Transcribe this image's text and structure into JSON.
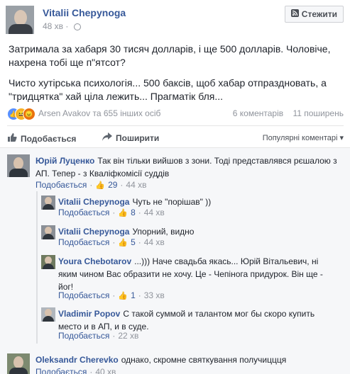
{
  "post": {
    "author": "Vitalii Chepynoga",
    "time": "48 хв",
    "follow_label": "Стежити",
    "paragraphs": [
      "Затримала за хабаря 30 тисяч долларів, і ще 500 долларів. Чоловіче, нахрена тобі ще п\"ятсот?",
      "Чисто хутірська психологія... 500 баксів, щоб хабар отпраздновать, а \"тридцятка\" хай ціла лежить... Прагматік бля..."
    ]
  },
  "reactions": {
    "summary": "Arsen Avakov та 655 інших осіб",
    "comments_count": "6 коментарів",
    "shares_count": "11 поширень"
  },
  "actions": {
    "like": "Подобається",
    "share": "Поширити",
    "sort": "Популярні коментарі ▾"
  },
  "comments": [
    {
      "name": "Юрій Луценко",
      "text": "Так він тільки вийшов з зони. Тоді представлявся рєшалою з АП. Тепер - з Кваліфкомісії суддів",
      "like": "Подобається",
      "likes": "29",
      "time": "44 хв"
    },
    {
      "name": "Vitalii Chepynoga",
      "text": "Чуть не \"порішав\" ))",
      "like": "Подобається",
      "likes": "8",
      "time": "44 хв"
    },
    {
      "name": "Vitalii Chepynoga",
      "text": "Упорний, видно",
      "like": "Подобається",
      "likes": "5",
      "time": "44 хв"
    },
    {
      "name": "Youra Chebotarov",
      "text": "...))) Наче свадьба якась... Юрій Вітальевич, ні яким чином Вас образити не хочу. Це - Чепінога придурок. Він ще - йог!",
      "like": "Подобається",
      "likes": "1",
      "time": "33 хв"
    },
    {
      "name": "Vladimir Popov",
      "text": "С такой суммой и талантом мог бы скоро купить место и в АП, и в суде.",
      "like": "Подобається",
      "time": "22 хв"
    },
    {
      "name": "Oleksandr Cherevko",
      "text": "однако, скромне святкування получиццця",
      "like": "Подобається",
      "time": "40 хв"
    }
  ]
}
